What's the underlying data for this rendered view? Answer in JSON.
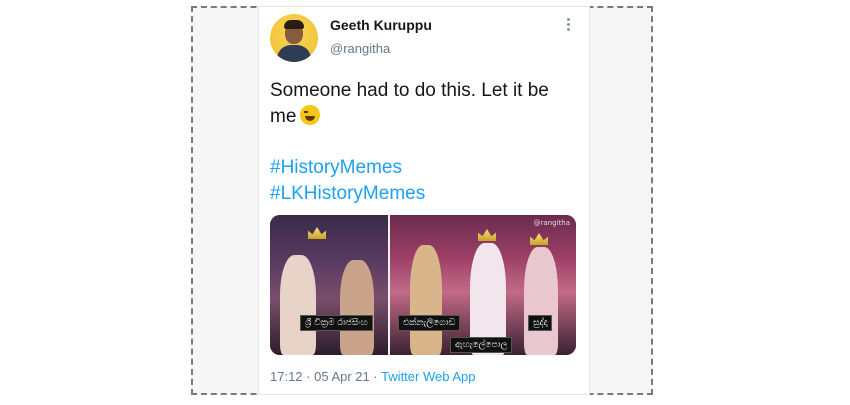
{
  "tweet": {
    "author_name": "Geeth Kuruppu",
    "author_handle": "@rangitha",
    "text": "Someone had to do this. Let it be me",
    "emoji_icon": "grinning-sweat-emoji",
    "hashtags": [
      "#HistoryMemes",
      "#LKHistoryMemes"
    ],
    "timestamp": "17:12 · 05 Apr 21 · ",
    "source": "Twitter Web App"
  },
  "media": {
    "watermark": "@rangitha",
    "captions": [
      "ශ්‍රී වික්‍රම රාජසිංහ",
      "එක්නැලිගොඩ",
      "ඇහැලේපොල",
      "සුද්දා"
    ]
  },
  "colors": {
    "link": "#1da1f2",
    "secondary_text": "#657786",
    "avatar_bg": "#f3c93c"
  }
}
